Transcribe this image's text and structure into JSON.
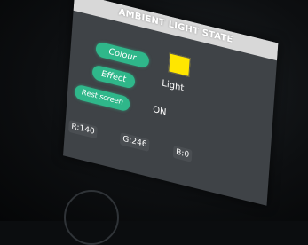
{
  "screen": {
    "title": "AMBIENT LIGHT STATE"
  },
  "buttons": {
    "colour": "Colour",
    "effect": "Effect",
    "rest_screen": "Rest screen"
  },
  "swatch": {
    "color": "#ffe600"
  },
  "labels": {
    "light": "Light",
    "state": "ON"
  },
  "rgb": {
    "r": "R:140",
    "g": "G:246",
    "b": "B:0"
  }
}
